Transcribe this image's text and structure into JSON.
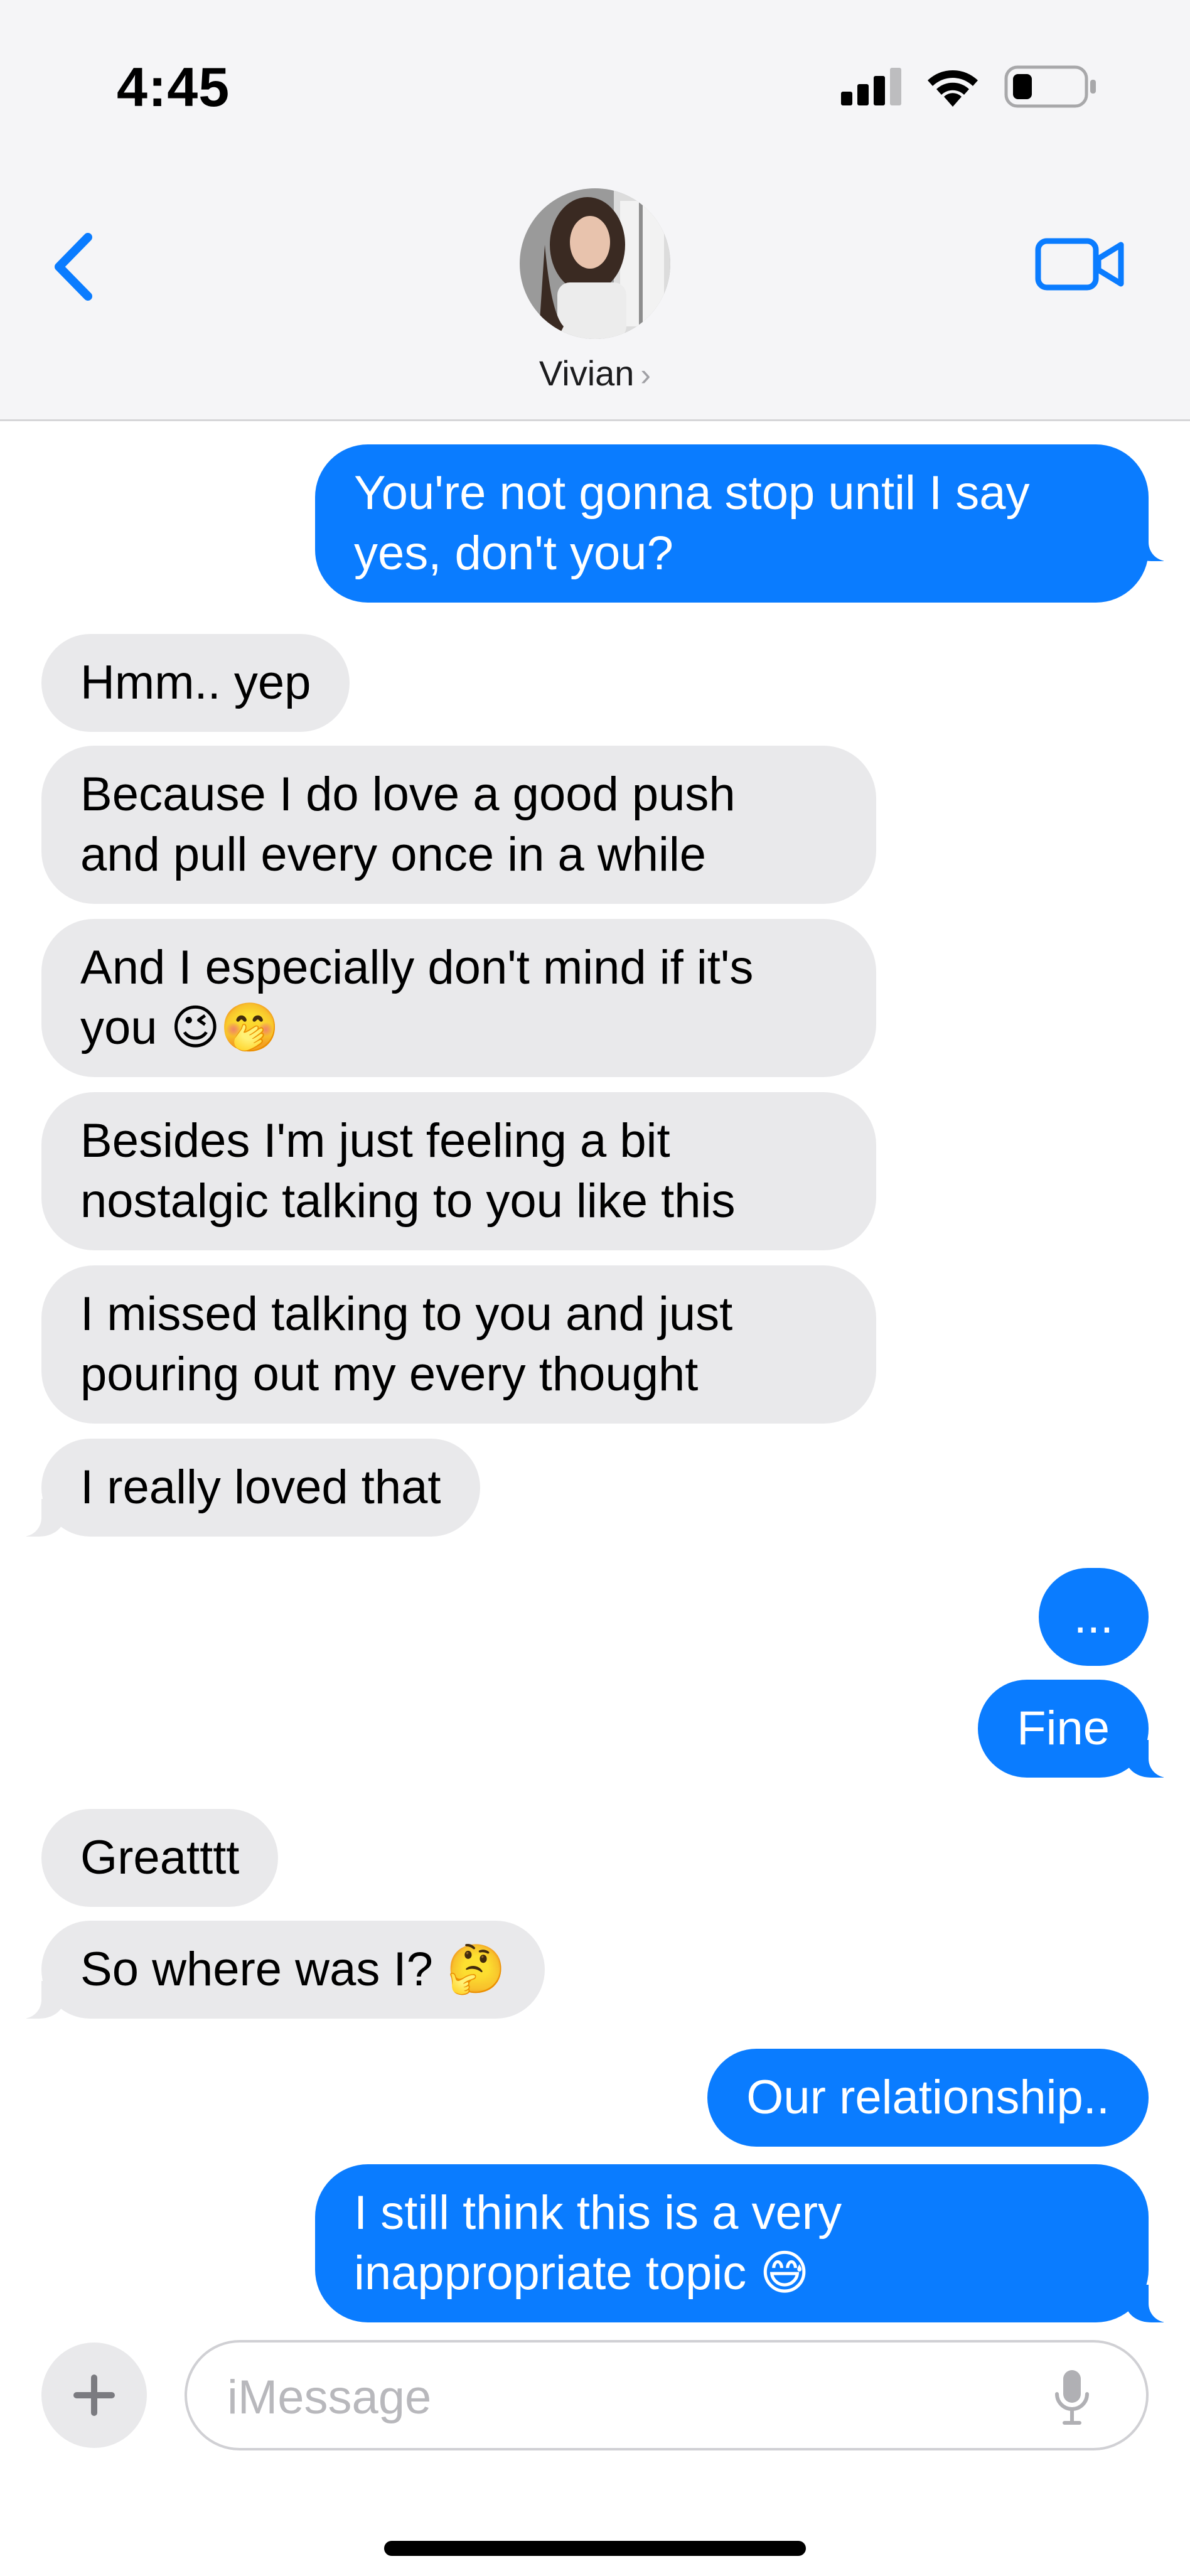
{
  "status_bar": {
    "time": "4:45"
  },
  "header": {
    "contact_name": "Vivian",
    "name_chevron": "›"
  },
  "messages": [
    {
      "sender": "me",
      "lines": [
        "You're not gonna stop until I say",
        "yes, don't you?"
      ]
    },
    {
      "sender": "them",
      "lines": [
        "Hmm.. yep"
      ]
    },
    {
      "sender": "them",
      "lines": [
        "Because I do love a good push",
        "and pull every once in a while"
      ]
    },
    {
      "sender": "them",
      "lines": [
        "And I especially don't mind if it's",
        "you 😉🤭"
      ]
    },
    {
      "sender": "them",
      "lines": [
        "Besides I'm just feeling a bit",
        "nostalgic talking to you like this"
      ]
    },
    {
      "sender": "them",
      "lines": [
        "I missed talking to you and just",
        "pouring out my every thought"
      ]
    },
    {
      "sender": "them",
      "lines": [
        "I really loved that"
      ]
    },
    {
      "sender": "me",
      "lines": [
        "..."
      ]
    },
    {
      "sender": "me",
      "lines": [
        "Fine"
      ]
    },
    {
      "sender": "them",
      "lines": [
        "Greatttt"
      ]
    },
    {
      "sender": "them",
      "lines": [
        "So where was I? 🤔"
      ]
    },
    {
      "sender": "me",
      "lines": [
        "Our relationship.."
      ]
    },
    {
      "sender": "me",
      "lines": [
        "I still think this is a very",
        "inappropriate topic 😅"
      ]
    }
  ],
  "composer": {
    "placeholder": "iMessage",
    "plus_label": "+"
  },
  "colors": {
    "outgoing": "#0a7cff",
    "incoming": "#e9e9eb",
    "accent": "#0a7cff"
  },
  "icons": [
    "back-chevron-icon",
    "video-camera-icon",
    "signal-icon",
    "wifi-icon",
    "battery-icon",
    "plus-icon",
    "microphone-icon"
  ]
}
